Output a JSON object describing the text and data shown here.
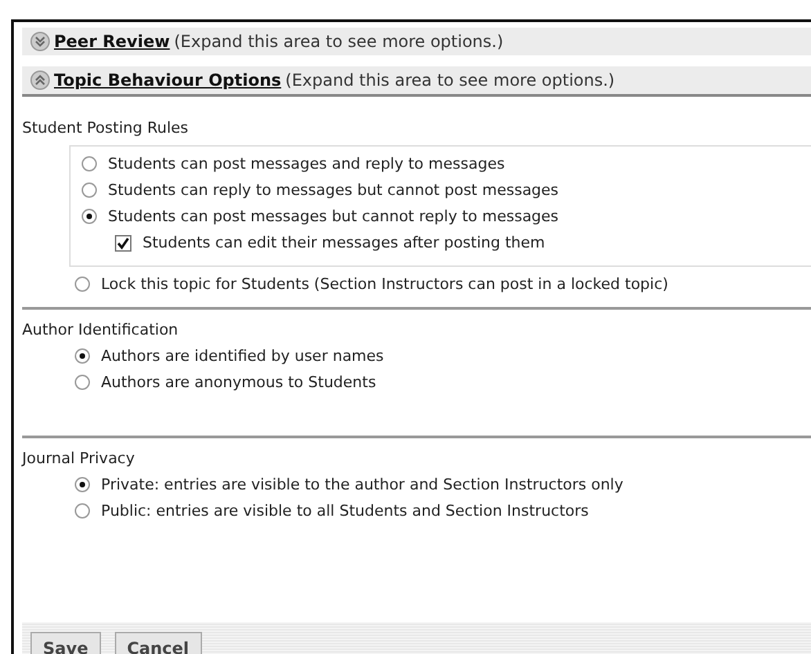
{
  "sections": [
    {
      "title": "Peer Review",
      "hint": "(Expand this area to see more options.)",
      "expanded": false
    },
    {
      "title": "Topic Behaviour Options",
      "hint": "(Expand this area to see more options.)",
      "expanded": true
    }
  ],
  "posting_rules": {
    "title": "Student Posting Rules",
    "boxed_options": [
      {
        "label": "Students can post messages and reply to messages",
        "selected": false
      },
      {
        "label": "Students can reply to messages but cannot post messages",
        "selected": false
      },
      {
        "label": "Students can post messages but cannot reply to messages",
        "selected": true,
        "sub_option": {
          "label": "Students can edit their messages after posting them",
          "checked": true
        }
      }
    ],
    "other_options": [
      {
        "label": "Lock this topic for Students (Section Instructors can post in a locked topic)",
        "selected": false
      }
    ]
  },
  "author_identification": {
    "title": "Author Identification",
    "options": [
      {
        "label": "Authors are identified by user names",
        "selected": true
      },
      {
        "label": "Authors are anonymous to Students",
        "selected": false
      }
    ]
  },
  "journal_privacy": {
    "title": "Journal Privacy",
    "options": [
      {
        "label": "Private: entries are visible to the author and Section Instructors only",
        "selected": true
      },
      {
        "label": "Public: entries are visible to all Students and Section Instructors",
        "selected": false
      }
    ]
  },
  "buttons": [
    "Save",
    "Cancel"
  ]
}
